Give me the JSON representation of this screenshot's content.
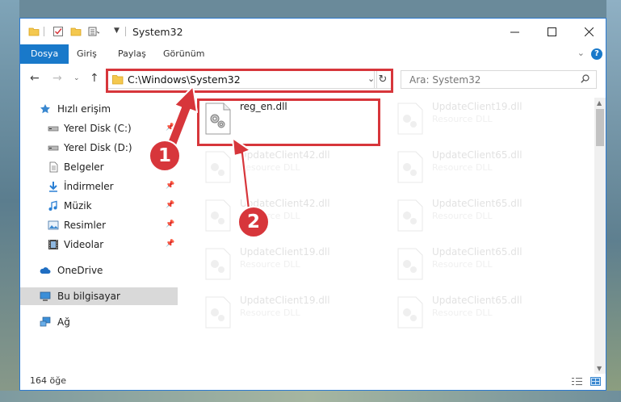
{
  "window": {
    "title": "System32",
    "accent_color": "#1979ca",
    "highlight_color": "#d7363b"
  },
  "ribbon": {
    "tabs": [
      {
        "label": "Dosya",
        "active": true
      },
      {
        "label": "Giriş",
        "active": false
      },
      {
        "label": "Paylaş",
        "active": false
      },
      {
        "label": "Görünüm",
        "active": false
      }
    ],
    "help_label": "?"
  },
  "navigation": {
    "address": "C:\\Windows\\System32",
    "search_placeholder": "Ara: System32"
  },
  "sidebar": {
    "items": [
      {
        "label": "Hızlı erişim",
        "icon": "star-icon",
        "pinned": false
      },
      {
        "label": "Yerel Disk (C:)",
        "icon": "drive-icon",
        "pinned": true
      },
      {
        "label": "Yerel Disk (D:)",
        "icon": "drive-icon",
        "pinned": false
      },
      {
        "label": "Belgeler",
        "icon": "documents-icon",
        "pinned": true
      },
      {
        "label": "İndirmeler",
        "icon": "download-icon",
        "pinned": true
      },
      {
        "label": "Müzik",
        "icon": "music-icon",
        "pinned": true
      },
      {
        "label": "Resimler",
        "icon": "pictures-icon",
        "pinned": true
      },
      {
        "label": "Videolar",
        "icon": "videos-icon",
        "pinned": true
      },
      {
        "label": "OneDrive",
        "icon": "cloud-icon",
        "pinned": false
      },
      {
        "label": "Bu bilgisayar",
        "icon": "computer-icon",
        "pinned": false,
        "selected": true
      },
      {
        "label": "Ağ",
        "icon": "network-icon",
        "pinned": false
      }
    ]
  },
  "files": [
    {
      "name": "reg_en.dll",
      "description": "",
      "highlighted": true
    },
    {
      "name": "UpdateClient19.dll",
      "description": "Resource DLL"
    },
    {
      "name": "UpdateClient42.dll",
      "description": "Resource DLL"
    },
    {
      "name": "UpdateClient65.dll",
      "description": "Resource DLL"
    },
    {
      "name": "UpdateClient42.dll",
      "description": "Resource DLL"
    },
    {
      "name": "UpdateClient65.dll",
      "description": "Resource DLL"
    },
    {
      "name": "UpdateClient19.dll",
      "description": "Resource DLL"
    },
    {
      "name": "UpdateClient65.dll",
      "description": "Resource DLL"
    },
    {
      "name": "UpdateClient19.dll",
      "description": "Resource DLL"
    },
    {
      "name": "UpdateClient65.dll",
      "description": "Resource DLL"
    }
  ],
  "callouts": [
    {
      "number": "1"
    },
    {
      "number": "2"
    }
  ],
  "status": {
    "item_count": "164 öğe"
  }
}
